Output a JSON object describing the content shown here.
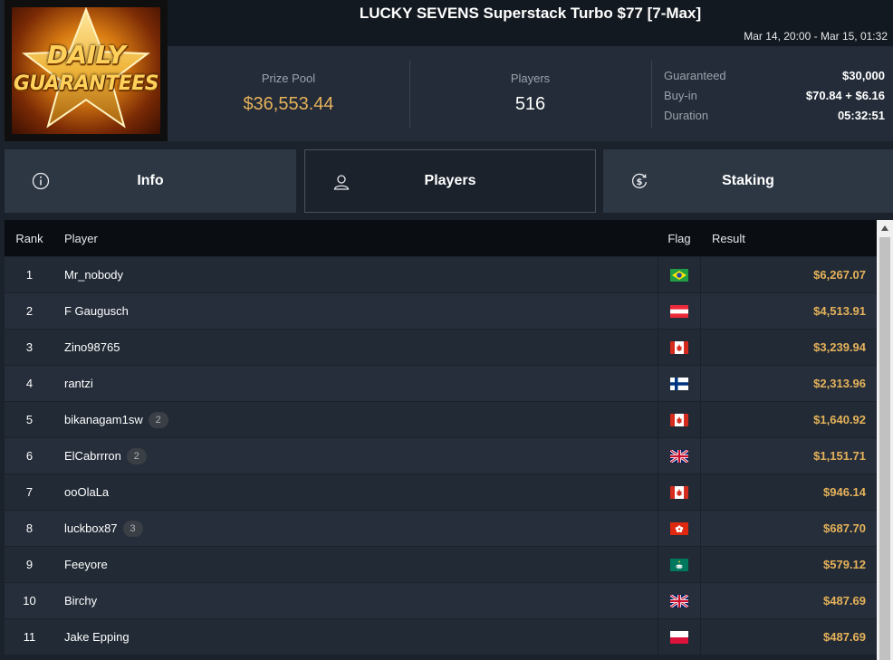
{
  "logo": {
    "line1": "DAILY",
    "line2": "GUARANTEES"
  },
  "header": {
    "title": "LUCKY SEVENS Superstack Turbo $77 [7-Max]",
    "dates": "Mar 14, 20:00 - Mar 15, 01:32"
  },
  "stats": {
    "prize_pool_label": "Prize Pool",
    "prize_pool_value": "$36,553.44",
    "players_label": "Players",
    "players_value": "516",
    "details": [
      {
        "label": "Guaranteed",
        "value": "$30,000"
      },
      {
        "label": "Buy-in",
        "value": "$70.84 + $6.16"
      },
      {
        "label": "Duration",
        "value": "05:32:51"
      }
    ]
  },
  "tabs": [
    {
      "label": "Info",
      "icon": "info-icon"
    },
    {
      "label": "Players",
      "icon": "user-icon",
      "active": true
    },
    {
      "label": "Staking",
      "icon": "dollar-cycle-icon"
    }
  ],
  "table": {
    "headers": {
      "rank": "Rank",
      "player": "Player",
      "flag": "Flag",
      "result": "Result"
    },
    "rows": [
      {
        "rank": "1",
        "player": "Mr_nobody",
        "badge": "",
        "flag": "brazil",
        "result": "$6,267.07"
      },
      {
        "rank": "2",
        "player": "F Gaugusch",
        "badge": "",
        "flag": "austria",
        "result": "$4,513.91"
      },
      {
        "rank": "3",
        "player": "Zino98765",
        "badge": "",
        "flag": "canada",
        "result": "$3,239.94"
      },
      {
        "rank": "4",
        "player": "rantzi",
        "badge": "",
        "flag": "finland",
        "result": "$2,313.96"
      },
      {
        "rank": "5",
        "player": "bikanagam1sw",
        "badge": "2",
        "flag": "canada",
        "result": "$1,640.92"
      },
      {
        "rank": "6",
        "player": "ElCabrrron",
        "badge": "2",
        "flag": "uk",
        "result": "$1,151.71"
      },
      {
        "rank": "7",
        "player": "ooOlaLa",
        "badge": "",
        "flag": "canada",
        "result": "$946.14"
      },
      {
        "rank": "8",
        "player": "luckbox87",
        "badge": "3",
        "flag": "hongkong",
        "result": "$687.70"
      },
      {
        "rank": "9",
        "player": "Feeyore",
        "badge": "",
        "flag": "macau",
        "result": "$579.12"
      },
      {
        "rank": "10",
        "player": "Birchy",
        "badge": "",
        "flag": "uk",
        "result": "$487.69"
      },
      {
        "rank": "11",
        "player": "Jake Epping",
        "badge": "",
        "flag": "poland",
        "result": "$487.69"
      }
    ]
  },
  "colors": {
    "accent_gold": "#e6b25a",
    "panel": "#232c38",
    "tab": "#2d3744"
  }
}
